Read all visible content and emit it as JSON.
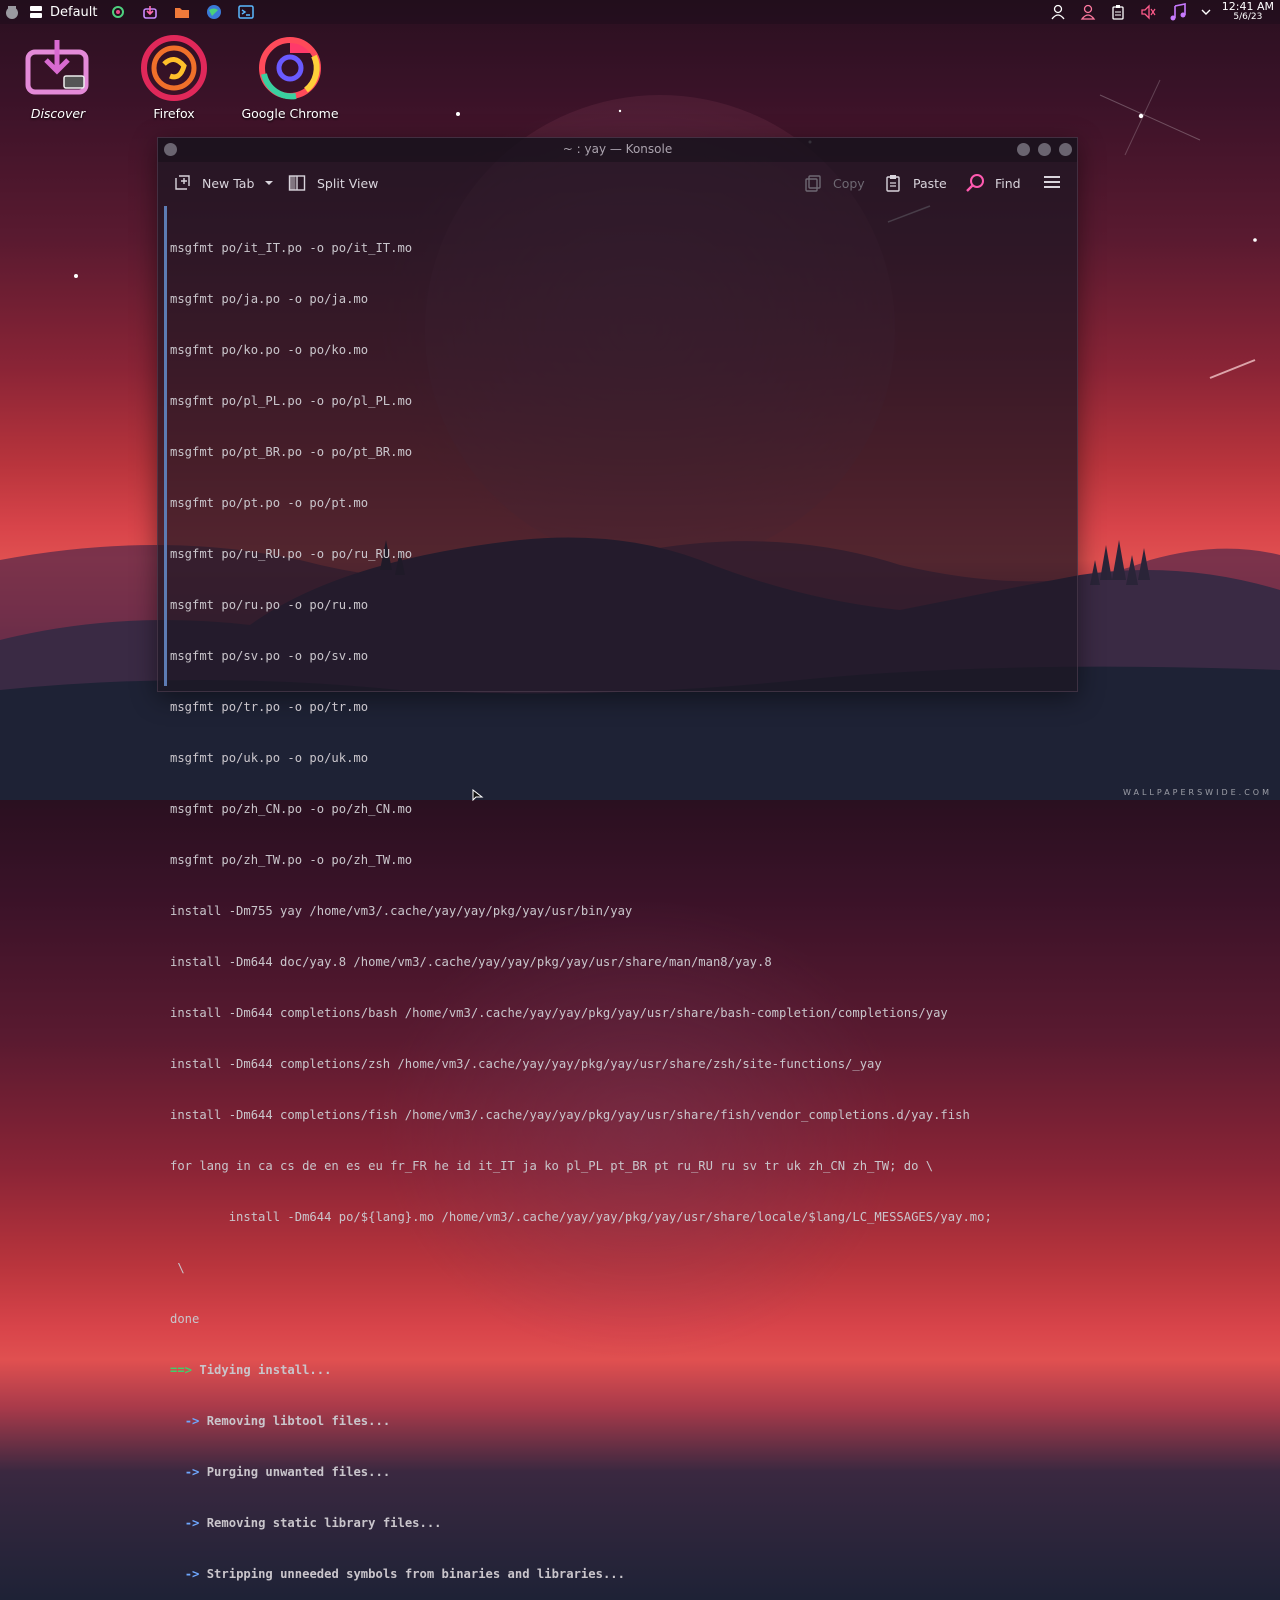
{
  "panel": {
    "activity_label": "Default",
    "clock_time": "12:41 AM",
    "clock_date": "5/6/23",
    "left_icons": [
      "app-launcher-icon",
      "activity-icon",
      "settings-icon",
      "discover-icon",
      "files-icon",
      "browser-icon",
      "terminal-icon"
    ],
    "right_icons": [
      "user-icon",
      "user-switch-icon",
      "clipboard-icon",
      "volume-muted-icon",
      "music-icon",
      "expand-tray-icon"
    ]
  },
  "desktop": {
    "icons": [
      {
        "label": "Discover"
      },
      {
        "label": "Firefox"
      },
      {
        "label": "Google Chrome"
      }
    ]
  },
  "konsole": {
    "title": "~ : yay — Konsole",
    "toolbar": {
      "new_tab": "New Tab",
      "split_view": "Split View",
      "copy": "Copy",
      "paste": "Paste",
      "find": "Find"
    },
    "lines": [
      "msgfmt po/it_IT.po -o po/it_IT.mo",
      "msgfmt po/ja.po -o po/ja.mo",
      "msgfmt po/ko.po -o po/ko.mo",
      "msgfmt po/pl_PL.po -o po/pl_PL.mo",
      "msgfmt po/pt_BR.po -o po/pt_BR.mo",
      "msgfmt po/pt.po -o po/pt.mo",
      "msgfmt po/ru_RU.po -o po/ru_RU.mo",
      "msgfmt po/ru.po -o po/ru.mo",
      "msgfmt po/sv.po -o po/sv.mo",
      "msgfmt po/tr.po -o po/tr.mo",
      "msgfmt po/uk.po -o po/uk.mo",
      "msgfmt po/zh_CN.po -o po/zh_CN.mo",
      "msgfmt po/zh_TW.po -o po/zh_TW.mo",
      "install -Dm755 yay /home/vm3/.cache/yay/yay/pkg/yay/usr/bin/yay",
      "install -Dm644 doc/yay.8 /home/vm3/.cache/yay/yay/pkg/yay/usr/share/man/man8/yay.8",
      "install -Dm644 completions/bash /home/vm3/.cache/yay/yay/pkg/yay/usr/share/bash-completion/completions/yay",
      "install -Dm644 completions/zsh /home/vm3/.cache/yay/yay/pkg/yay/usr/share/zsh/site-functions/_yay",
      "install -Dm644 completions/fish /home/vm3/.cache/yay/yay/pkg/yay/usr/share/fish/vendor_completions.d/yay.fish",
      "for lang in ca cs de en es eu fr_FR he id it_IT ja ko pl_PL pt_BR pt ru_RU ru sv tr uk zh_CN zh_TW; do \\",
      "        install -Dm644 po/${lang}.mo /home/vm3/.cache/yay/yay/pkg/yay/usr/share/locale/$lang/LC_MESSAGES/yay.mo;",
      " \\",
      "done"
    ],
    "tidy_arrow": "==>",
    "tidy_text": "Tidying install...",
    "sub_arrow": "->",
    "steps": [
      "Removing libtool files...",
      "Purging unwanted files...",
      "Removing static library files...",
      "Stripping unneeded symbols from binaries and libraries..."
    ]
  },
  "watermark": "WALLPAPERSWIDE.COM"
}
